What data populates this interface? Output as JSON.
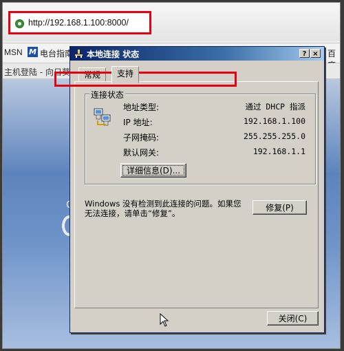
{
  "browser": {
    "url": "http://192.168.1.100:8000/",
    "links": {
      "msn": "MSN",
      "tv_guide": "电台指南",
      "baidu": "百度"
    },
    "tab_title": "主机登陆 - 向日葵",
    "page_partial_text": "C"
  },
  "dialog": {
    "title": "本地连接 状态",
    "help_button": "?",
    "close_button": "×",
    "tabs": [
      {
        "label": "常规",
        "active": false
      },
      {
        "label": "支持",
        "active": true
      }
    ],
    "group_title": "连接状态",
    "rows": [
      {
        "label": "地址类型:",
        "value": "通过 DHCP 指派"
      },
      {
        "label": "IP 地址:",
        "value": "192.168.1.100"
      },
      {
        "label": "子网掩码:",
        "value": "255.255.255.0"
      },
      {
        "label": "默认网关:",
        "value": "192.168.1.1"
      }
    ],
    "details_button": "详细信息(D)...",
    "message": "Windows 没有检测到此连接的问题。如果您无法连接，请单击“修复”。",
    "repair_button": "修复(P)",
    "close_label": "关闭(C)"
  },
  "colors": {
    "highlight_box": "#e8000e",
    "titlebar": "#0a246a"
  }
}
